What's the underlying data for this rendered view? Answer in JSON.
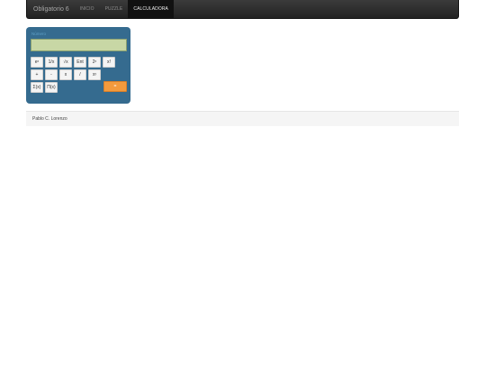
{
  "navbar": {
    "brand": "Obligatorio 6",
    "links": [
      "INICIO",
      "PUZZLE",
      "CALCULADORA"
    ],
    "active": "CALCULADORA"
  },
  "calculator": {
    "label": "Número",
    "display_value": "",
    "keys": {
      "row1": [
        "eˣ",
        "1/x",
        "√x",
        "Ent",
        "2ˣ",
        "x!"
      ],
      "row2": [
        "+",
        "-",
        "x",
        "/",
        "xʸ"
      ],
      "row3": [
        "Σ(x)",
        "Π(x)"
      ],
      "equals": "="
    }
  },
  "footer": {
    "text": "Pablo C. Lorenzo"
  },
  "colors": {
    "navbar": "#2b2b2b",
    "calculator_bg": "#356b8f",
    "display_bg": "#c8d7a5",
    "equals_key": "#f39a3d"
  }
}
